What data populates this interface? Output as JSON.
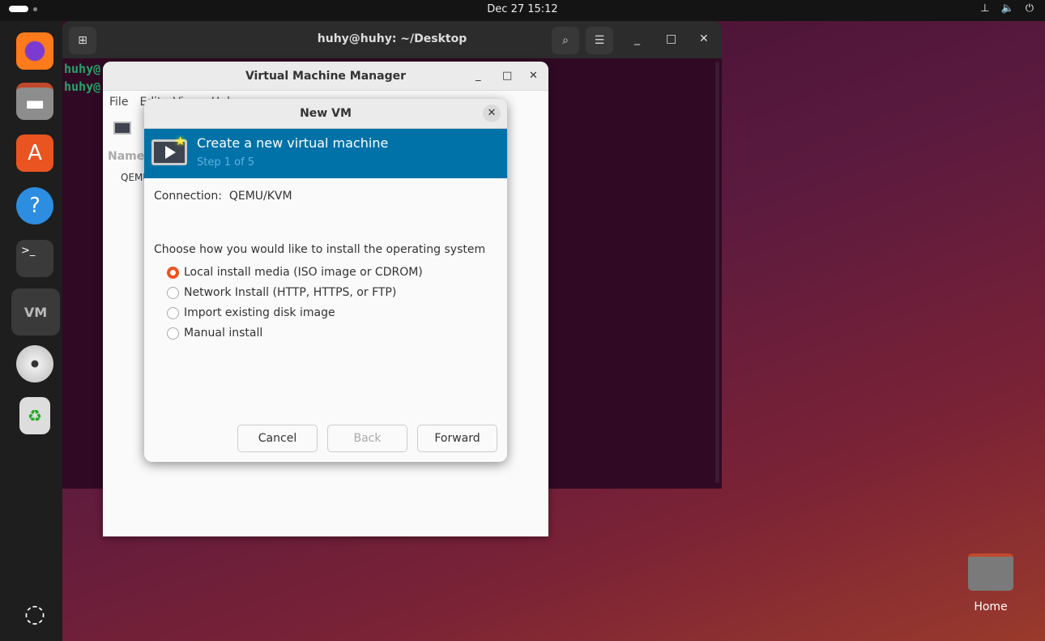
{
  "topbar": {
    "clock": "Dec 27  15:12",
    "tray": [
      "network-icon",
      "volume-icon",
      "power-icon"
    ]
  },
  "dock": {
    "items": [
      "firefox",
      "files",
      "app-center",
      "help",
      "terminal",
      "virt-manager",
      "disc",
      "trash",
      "show-apps"
    ]
  },
  "terminal": {
    "title": "huhy@huhy: ~/Desktop",
    "lines": [
      "huhy@",
      "huhy@"
    ]
  },
  "vmm": {
    "title": "Virtual Machine Manager",
    "menu": [
      "File",
      "Edit",
      "View",
      "Help"
    ],
    "column": "Name",
    "row": "QEMU"
  },
  "dialog": {
    "title": "New VM",
    "header_title": "Create a new virtual machine",
    "header_step": "Step 1 of 5",
    "connection_label": "Connection:",
    "connection_value": "QEMU/KVM",
    "prompt": "Choose how you would like to install the operating system",
    "options": [
      {
        "label": "Local install media (ISO image or CDROM)",
        "selected": true
      },
      {
        "label": "Network Install (HTTP, HTTPS, or FTP)",
        "selected": false
      },
      {
        "label": "Import existing disk image",
        "selected": false
      },
      {
        "label": "Manual install",
        "selected": false
      }
    ],
    "buttons": {
      "cancel": "Cancel",
      "back": "Back",
      "forward": "Forward"
    },
    "accent": "#0072a8",
    "radio_color": "#e95420"
  },
  "desktop": {
    "home_label": "Home"
  }
}
